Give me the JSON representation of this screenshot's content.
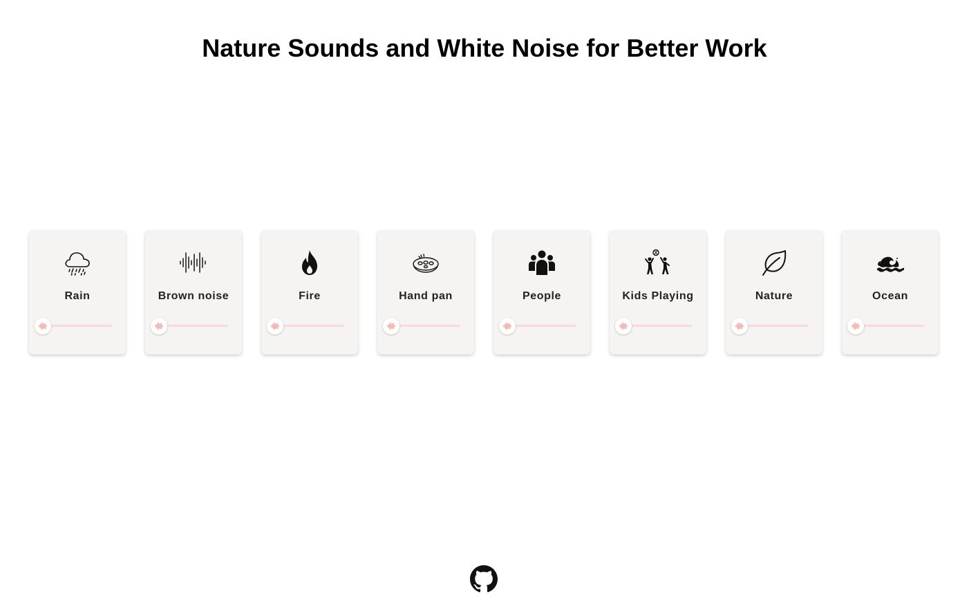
{
  "page": {
    "title": "Nature Sounds and White Noise for Better Work"
  },
  "colors": {
    "card_bg": "#f5f4f3",
    "slider_track": "#fbd9d9",
    "slider_accent": "#e8847a",
    "icon": "#111111"
  },
  "sounds": [
    {
      "label": "Rain",
      "icon": "cloud-rain-icon",
      "volume": 0
    },
    {
      "label": "Brown noise",
      "icon": "waveform-icon",
      "volume": 0
    },
    {
      "label": "Fire",
      "icon": "fire-icon",
      "volume": 0
    },
    {
      "label": "Hand pan",
      "icon": "hand-pan-icon",
      "volume": 0
    },
    {
      "label": "People",
      "icon": "people-group-icon",
      "volume": 0
    },
    {
      "label": "Kids Playing",
      "icon": "kids-playing-icon",
      "volume": 0
    },
    {
      "label": "Nature",
      "icon": "leaf-icon",
      "volume": 0
    },
    {
      "label": "Ocean",
      "icon": "wave-icon",
      "volume": 0
    }
  ],
  "footer": {
    "icon": "github-icon"
  }
}
